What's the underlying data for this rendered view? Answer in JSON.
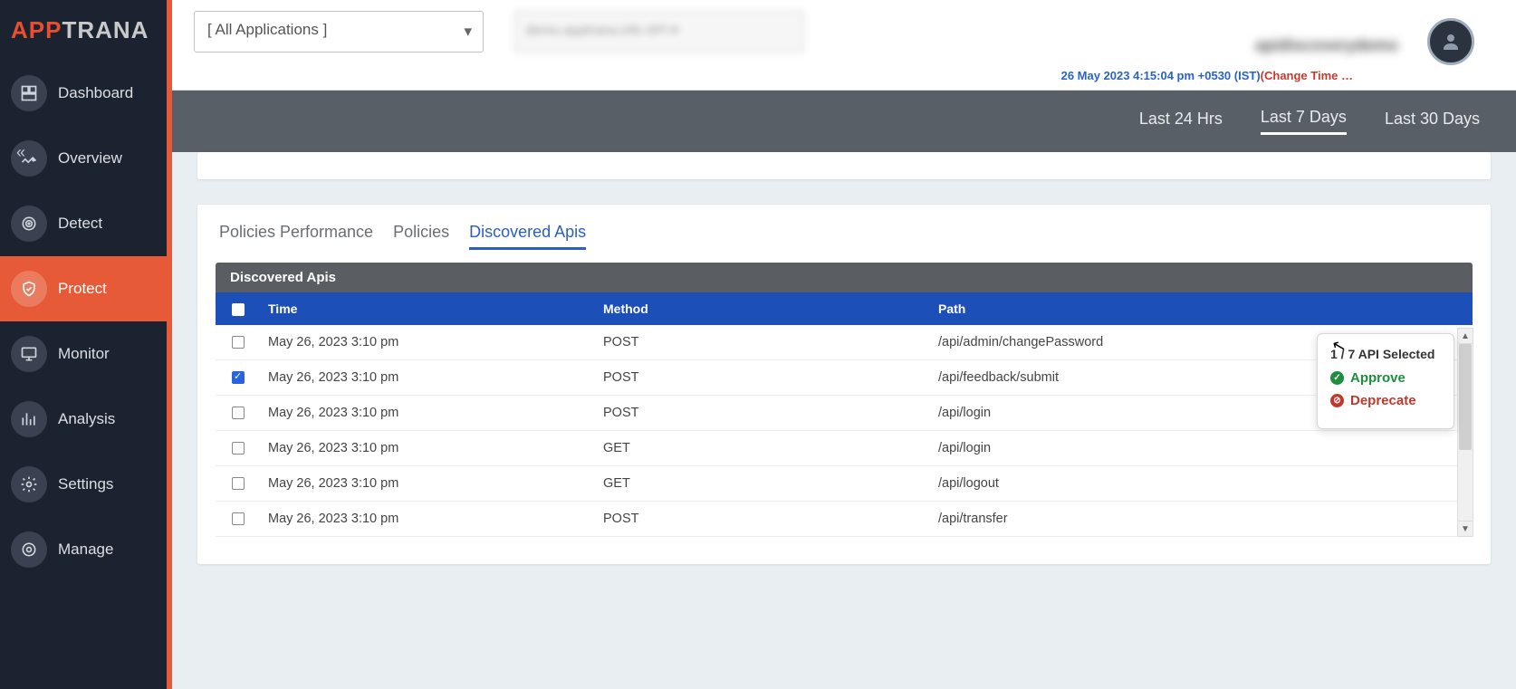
{
  "logo": {
    "part1": "APP",
    "part2": "TRANA"
  },
  "sidebar": {
    "items": [
      {
        "label": "Dashboard"
      },
      {
        "label": "Overview"
      },
      {
        "label": "Detect"
      },
      {
        "label": "Protect"
      },
      {
        "label": "Monitor"
      },
      {
        "label": "Analysis"
      },
      {
        "label": "Settings"
      },
      {
        "label": "Manage"
      }
    ]
  },
  "header": {
    "app_select": "[ All Applications ]",
    "timestamp": "26 May 2023 4:15:04 pm +0530 (IST)",
    "change_time": "(Change Time …"
  },
  "timerange": {
    "items": [
      {
        "label": "Last 24 Hrs"
      },
      {
        "label": "Last 7 Days"
      },
      {
        "label": "Last 30 Days"
      }
    ]
  },
  "tabs": [
    {
      "label": "Policies Performance"
    },
    {
      "label": "Policies"
    },
    {
      "label": "Discovered Apis"
    }
  ],
  "table": {
    "title": "Discovered Apis",
    "headers": {
      "time": "Time",
      "method": "Method",
      "path": "Path"
    },
    "rows": [
      {
        "checked": false,
        "time": "May 26, 2023 3:10 pm",
        "method": "POST",
        "path": "/api/admin/changePassword"
      },
      {
        "checked": true,
        "time": "May 26, 2023 3:10 pm",
        "method": "POST",
        "path": "/api/feedback/submit"
      },
      {
        "checked": false,
        "time": "May 26, 2023 3:10 pm",
        "method": "POST",
        "path": "/api/login"
      },
      {
        "checked": false,
        "time": "May 26, 2023 3:10 pm",
        "method": "GET",
        "path": "/api/login"
      },
      {
        "checked": false,
        "time": "May 26, 2023 3:10 pm",
        "method": "GET",
        "path": "/api/logout"
      },
      {
        "checked": false,
        "time": "May 26, 2023 3:10 pm",
        "method": "POST",
        "path": "/api/transfer"
      }
    ]
  },
  "popup": {
    "selected_text": "1 / 7 API Selected",
    "approve": "Approve",
    "deprecate": "Deprecate"
  }
}
